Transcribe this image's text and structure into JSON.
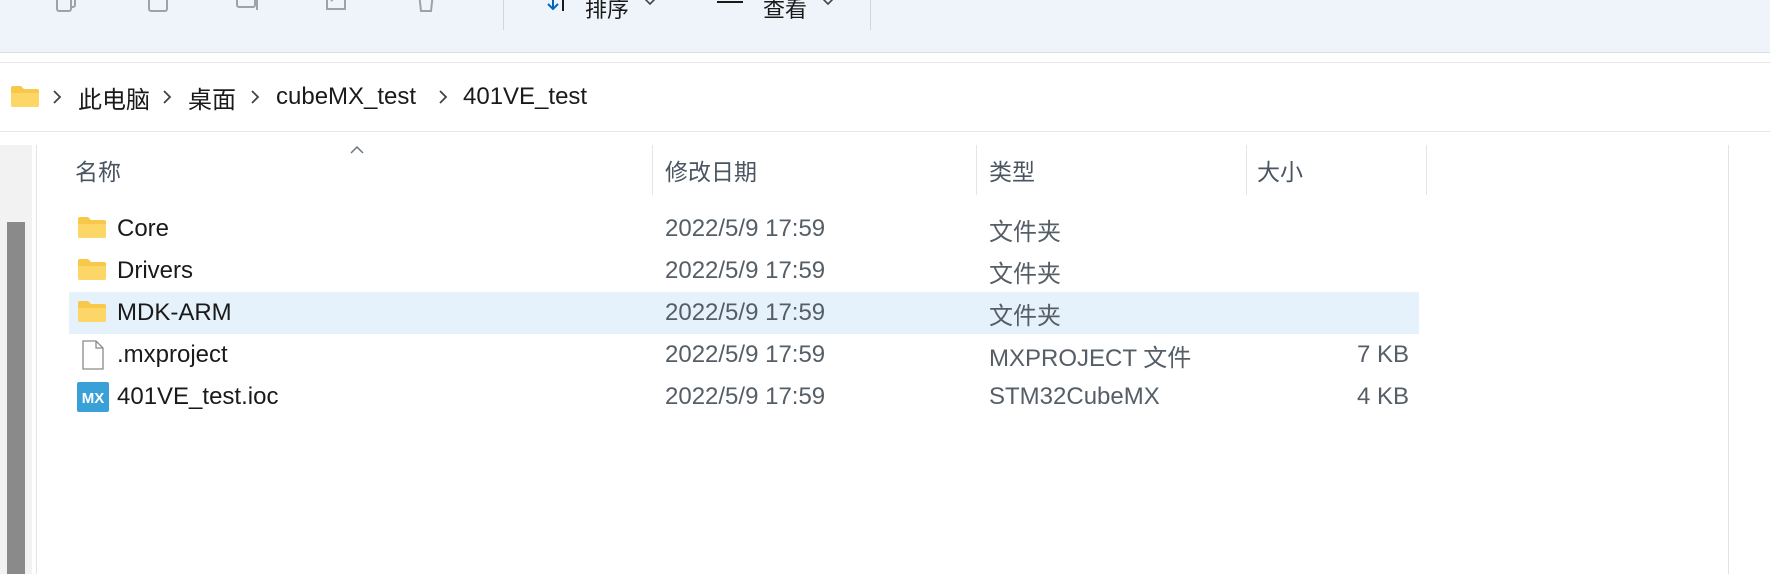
{
  "toolbar": {
    "sort_label": "排序",
    "view_label": "查看",
    "more_label": "···"
  },
  "breadcrumb": {
    "items": [
      "此电脑",
      "桌面",
      "cubeMX_test",
      "401VE_test"
    ]
  },
  "columns": {
    "name": "名称",
    "date": "修改日期",
    "type": "类型",
    "size": "大小"
  },
  "files": [
    {
      "name": "Core",
      "date": "2022/5/9 17:59",
      "type": "文件夹",
      "size": "",
      "icon": "folder-icon"
    },
    {
      "name": "Drivers",
      "date": "2022/5/9 17:59",
      "type": "文件夹",
      "size": "",
      "icon": "folder-icon"
    },
    {
      "name": "MDK-ARM",
      "date": "2022/5/9 17:59",
      "type": "文件夹",
      "size": "",
      "icon": "folder-icon",
      "selected": true
    },
    {
      "name": ".mxproject",
      "date": "2022/5/9 17:59",
      "type": "MXPROJECT 文件",
      "size": "7 KB",
      "icon": "file-icon"
    },
    {
      "name": "401VE_test.ioc",
      "date": "2022/5/9 17:59",
      "type": "STM32CubeMX",
      "size": "4 KB",
      "icon": "cubemx-icon"
    }
  ],
  "colors": {
    "accent": "#0067c0",
    "folder": "#f8c84a",
    "selection": "#e5f1fb",
    "cubemx": "#3aa0d8"
  }
}
